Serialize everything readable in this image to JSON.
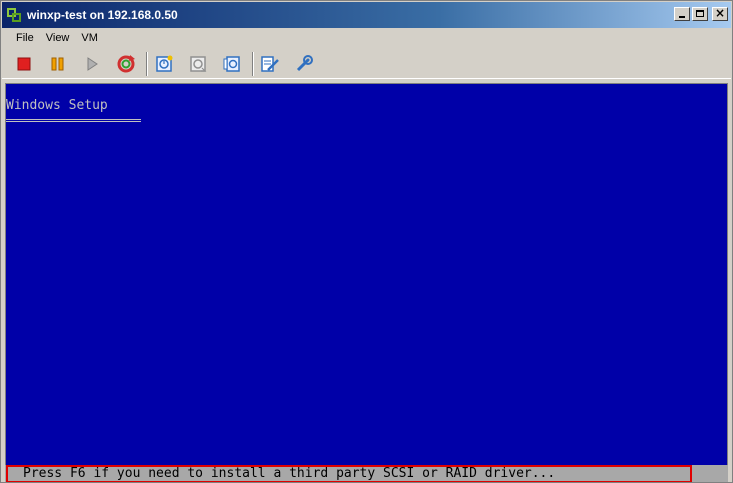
{
  "window": {
    "title": "winxp-test on 192.168.0.50",
    "controls": {
      "minimize": "minimize-icon",
      "maximize": "maximize-icon",
      "close": "×"
    }
  },
  "menu": {
    "items": [
      "File",
      "View",
      "VM"
    ]
  },
  "toolbar": {
    "buttons": [
      {
        "icon": "stop-icon",
        "color": "#e02020"
      },
      {
        "icon": "pause-icon",
        "color": "#f0a000"
      },
      {
        "icon": "play-icon",
        "color": "#a0a0a0"
      },
      {
        "icon": "reset-icon",
        "color": "#d03030"
      },
      {
        "icon": "snapshot-take-icon",
        "color": "#3070c0"
      },
      {
        "icon": "snapshot-revert-icon",
        "color": "#909090"
      },
      {
        "icon": "snapshot-manager-icon",
        "color": "#3070c0"
      },
      {
        "icon": "edit-settings-icon",
        "color": "#3070c0"
      },
      {
        "icon": "vm-tools-icon",
        "color": "#3070c0"
      }
    ]
  },
  "console": {
    "background": "#0000a8",
    "setup_title": "Windows Setup",
    "status_text": "Press F6 if you need to install a third party SCSI or RAID driver...",
    "status_background": "#a8a8a8",
    "highlight_color": "#e00000"
  }
}
